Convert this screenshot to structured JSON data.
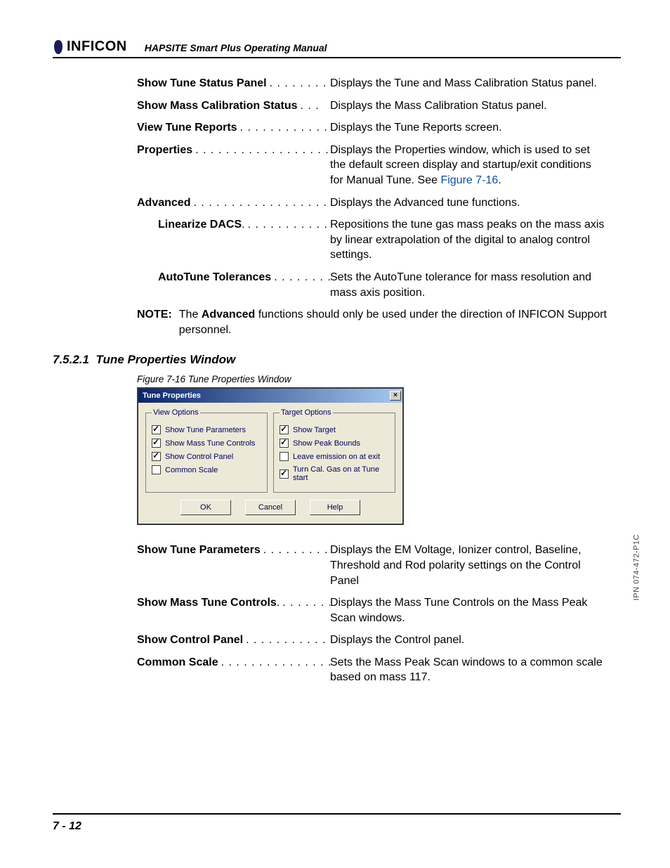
{
  "header": {
    "brand": "INFICON",
    "manual_title": "HAPSITE Smart Plus Operating Manual"
  },
  "definitions1": [
    {
      "term": "Show Tune Status Panel",
      "desc": "Displays the Tune and Mass Calibration Status panel.",
      "indent": false
    },
    {
      "term": "Show Mass Calibration Status",
      "desc": "Displays the Mass Calibration Status panel.",
      "indent": false
    },
    {
      "term": "View Tune Reports",
      "desc": "Displays the Tune Reports screen.",
      "indent": false
    },
    {
      "term": "Properties",
      "desc_pre": "Displays the Properties window, which is used to set the default screen display and startup/exit conditions for Manual Tune. See ",
      "link": "Figure 7-16",
      "desc_post": ".",
      "indent": false
    },
    {
      "term": "Advanced",
      "desc": "Displays the Advanced tune functions.",
      "indent": false
    },
    {
      "term": "Linearize DACS",
      "desc": "Repositions the tune gas mass peaks on the mass axis by linear extrapolation of the digital to analog control settings.",
      "indent": true,
      "trailing_dot": true
    },
    {
      "term": "AutoTune Tolerances",
      "desc": "Sets the AutoTune tolerance for mass resolution and mass axis position.",
      "indent": true
    }
  ],
  "note": {
    "label": "NOTE:",
    "body_pre": "The ",
    "body_bold": "Advanced",
    "body_post": " functions should only be used under the direction of INFICON Support personnel."
  },
  "section": {
    "number": "7.5.2.1",
    "title": "Tune Properties Window"
  },
  "figure": {
    "caption": "Figure 7-16  Tune Properties Window"
  },
  "dialog": {
    "title": "Tune Properties",
    "view_legend": "View Options",
    "target_legend": "Target Options",
    "view_opts": [
      {
        "label": "Show Tune Parameters",
        "checked": true
      },
      {
        "label": "Show Mass Tune Controls",
        "checked": true
      },
      {
        "label": "Show Control Panel",
        "checked": true
      },
      {
        "label": "Common Scale",
        "checked": false
      }
    ],
    "target_opts": [
      {
        "label": "Show Target",
        "checked": true
      },
      {
        "label": "Show Peak Bounds",
        "checked": true
      },
      {
        "label": "Leave emission on at exit",
        "checked": false
      },
      {
        "label": "Turn Cal. Gas on at Tune start",
        "checked": true
      }
    ],
    "buttons": {
      "ok": "OK",
      "cancel": "Cancel",
      "help": "Help"
    }
  },
  "definitions2": [
    {
      "term": "Show Tune Parameters",
      "desc": "Displays the EM Voltage, Ionizer control, Baseline, Threshold and Rod polarity settings on the Control Panel"
    },
    {
      "term": "Show Mass Tune Controls",
      "desc": "Displays the Mass Tune Controls on the Mass Peak Scan windows.",
      "trailing_dot": true
    },
    {
      "term": "Show Control Panel",
      "desc": "Displays the Control panel."
    },
    {
      "term": "Common Scale",
      "desc": "Sets the Mass Peak Scan windows to a common scale based on mass 117."
    }
  ],
  "footer": {
    "page": "7 - 12"
  },
  "side": "IPN 074-472-P1C"
}
